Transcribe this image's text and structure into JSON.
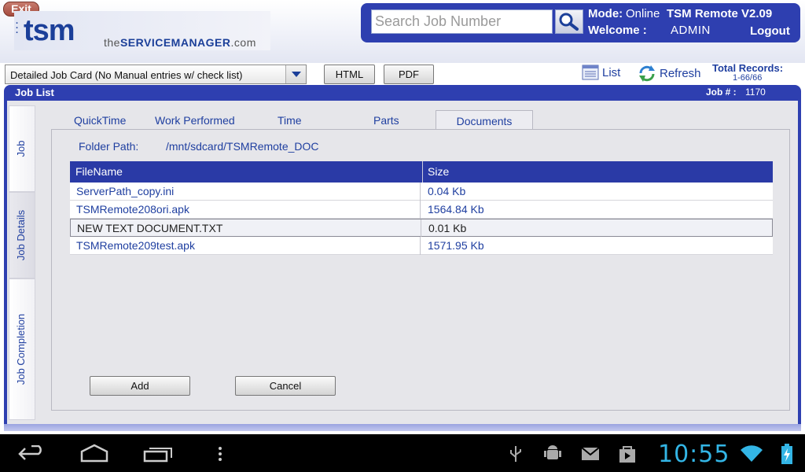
{
  "header": {
    "exit_label": "Exit",
    "logo_main": "tsm",
    "logo_sub_prefix": "the",
    "logo_sub_brand": "SERVICEMANAGER",
    "logo_sub_suffix": ".com",
    "search": {
      "placeholder": "Search Job Number",
      "value": ""
    },
    "mode_label": "Mode:",
    "mode_value": "Online",
    "app_version": "TSM Remote V2.09",
    "welcome_label": "Welcome :",
    "user": "ADMIN",
    "logout_label": "Logout"
  },
  "toolbar": {
    "report_select": {
      "selected": "Detailed Job Card (No Manual entries w/ check list)"
    },
    "html_label": "HTML",
    "pdf_label": "PDF",
    "list_label": "List",
    "refresh_label": "Refresh",
    "total_records_label": "Total Records:",
    "total_records_value": "1-66/66"
  },
  "frame": {
    "title": "Job List",
    "job_number_label": "Job # :",
    "job_number": "1170"
  },
  "side_tabs": [
    {
      "label": "Job"
    },
    {
      "label": "Job Details",
      "active": true
    },
    {
      "label": "Job Completion"
    }
  ],
  "tabs": [
    {
      "label": "QuickTime"
    },
    {
      "label": "Work Performed"
    },
    {
      "label": "Time"
    },
    {
      "label": "Parts"
    },
    {
      "label": "Documents",
      "active": true
    }
  ],
  "documents": {
    "folder_label": "Folder Path:",
    "folder_path": "/mnt/sdcard/TSMRemote_DOC",
    "columns": [
      "FileName",
      "Size"
    ],
    "rows": [
      {
        "filename": "ServerPath_copy.ini",
        "size": "0.04 Kb"
      },
      {
        "filename": "TSMRemote208ori.apk",
        "size": "1564.84 Kb"
      },
      {
        "filename": "NEW TEXT DOCUMENT.TXT",
        "size": "0.01 Kb",
        "selected": true
      },
      {
        "filename": "TSMRemote209test.apk",
        "size": "1571.95 Kb"
      }
    ],
    "add_label": "Add",
    "cancel_label": "Cancel"
  },
  "system_bar": {
    "time": "10:55",
    "icons": [
      "back-icon",
      "home-icon",
      "recent-apps-icon",
      "menu-icon",
      "usb-icon",
      "android-debug-icon",
      "gmail-icon",
      "store-icon",
      "wifi-icon",
      "battery-icon"
    ]
  },
  "colors": {
    "brand_blue": "#2e3fb0",
    "table_header": "#2a3aa6",
    "link_text": "#1f3fa0",
    "clock": "#33b5e5",
    "exit_red": "#a64c3e"
  }
}
